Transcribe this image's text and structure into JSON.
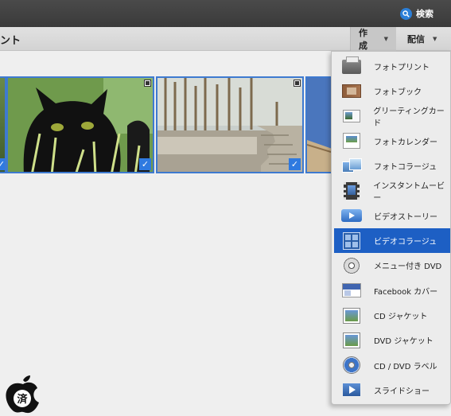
{
  "toolbar": {
    "search_label": "検索"
  },
  "header": {
    "title_fragment": "ント",
    "create_label": "作成",
    "share_label": "配信"
  },
  "menu": {
    "items": [
      {
        "label": "フォトプリント",
        "icon": "printer-icon"
      },
      {
        "label": "フォトブック",
        "icon": "photo-book-icon"
      },
      {
        "label": "グリーティングカード",
        "icon": "greeting-card-icon"
      },
      {
        "label": "フォトカレンダー",
        "icon": "calendar-icon"
      },
      {
        "label": "フォトコラージュ",
        "icon": "photo-collage-icon"
      },
      {
        "label": "インスタントムービー",
        "icon": "film-icon"
      },
      {
        "label": "ビデオストーリー",
        "icon": "video-story-icon"
      },
      {
        "label": "ビデオコラージュ",
        "icon": "video-collage-icon",
        "selected": true
      },
      {
        "label": "メニュー付き DVD",
        "icon": "dvd-icon"
      },
      {
        "label": "Facebook カバー",
        "icon": "facebook-cover-icon"
      },
      {
        "label": "CD ジャケット",
        "icon": "cd-jacket-icon"
      },
      {
        "label": "DVD ジャケット",
        "icon": "dvd-jacket-icon"
      },
      {
        "label": "CD / DVD ラベル",
        "icon": "disc-label-icon"
      },
      {
        "label": "スライドショー",
        "icon": "slideshow-icon"
      }
    ]
  },
  "watermark": {
    "text": "済"
  },
  "colors": {
    "accent": "#1d5fc4",
    "selection_border": "#3e7ad0",
    "topbar": "#3f3f3f"
  }
}
